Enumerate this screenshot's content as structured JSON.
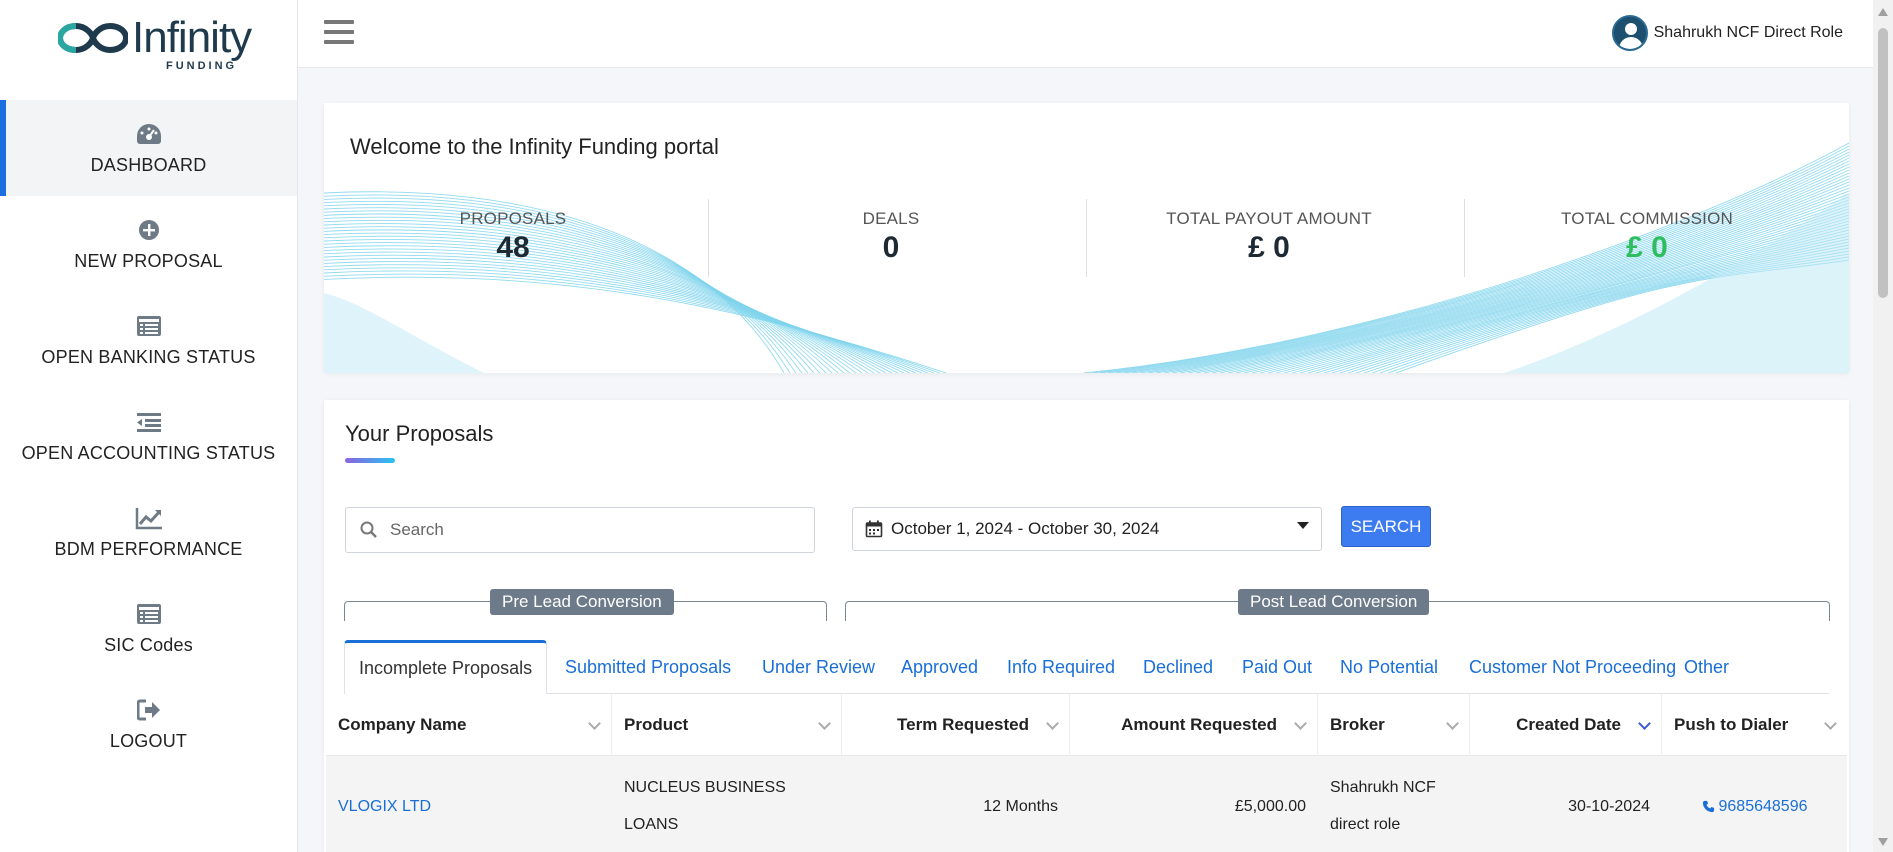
{
  "brand": {
    "name": "Infinity",
    "sub": "FUNDING"
  },
  "sidebar": {
    "items": [
      {
        "label": "DASHBOARD",
        "icon": "dashboard-icon",
        "active": true
      },
      {
        "label": "NEW PROPOSAL",
        "icon": "plus-circle-icon"
      },
      {
        "label": "OPEN BANKING STATUS",
        "icon": "list-card-icon"
      },
      {
        "label": "OPEN ACCOUNTING STATUS",
        "icon": "indent-list-icon"
      },
      {
        "label": "BDM PERFORMANCE",
        "icon": "line-chart-icon"
      },
      {
        "label": "SIC Codes",
        "icon": "list-card-icon"
      },
      {
        "label": "LOGOUT",
        "icon": "logout-icon"
      }
    ]
  },
  "header": {
    "user_name": "Shahrukh NCF Direct Role"
  },
  "welcome": {
    "title": "Welcome to the Infinity Funding portal",
    "stats": [
      {
        "label": "PROPOSALS",
        "value": "48"
      },
      {
        "label": "DEALS",
        "value": "0"
      },
      {
        "label": "TOTAL PAYOUT AMOUNT",
        "value": "£ 0"
      },
      {
        "label": "TOTAL COMMISSION",
        "value": "£ 0"
      }
    ]
  },
  "proposals": {
    "title": "Your Proposals",
    "search_placeholder": "Search",
    "date_range": "October 1, 2024 - October 30, 2024",
    "search_button": "SEARCH",
    "groups": {
      "pre": "Pre Lead Conversion",
      "post": "Post Lead Conversion"
    },
    "tabs": [
      "Incomplete Proposals",
      "Submitted Proposals",
      "Under Review",
      "Approved",
      "Info Required",
      "Declined",
      "Paid Out",
      "No Potential",
      "Customer Not Proceeding",
      "Other"
    ],
    "columns": [
      "Company Name",
      "Product",
      "Term Requested",
      "Amount Requested",
      "Broker",
      "Created Date",
      "Push to Dialer"
    ],
    "rows": [
      {
        "company": "VLOGIX LTD",
        "product": "NUCLEUS BUSINESS LOANS",
        "term": "12 Months",
        "amount": "£5,000.00",
        "broker": "Shahrukh NCF direct role",
        "created": "30-10-2024",
        "phone": "9685648596"
      }
    ]
  },
  "colors": {
    "accent": "#1a6fd6",
    "button": "#3d7bf0",
    "commission": "#2ebd5f",
    "group_label": "#6c7a89"
  }
}
